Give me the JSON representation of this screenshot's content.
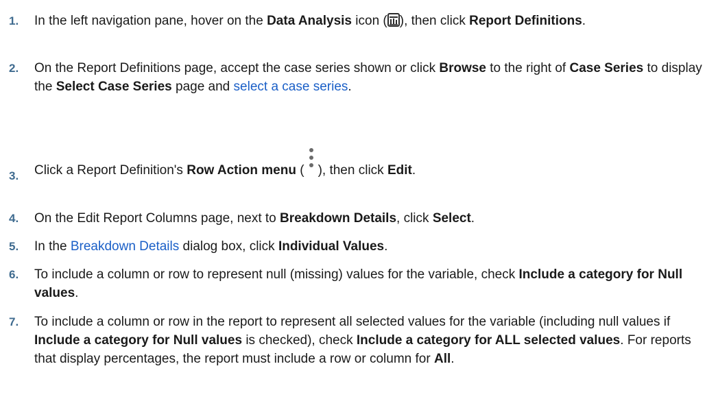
{
  "steps": [
    {
      "number": "1.",
      "parts": [
        {
          "t": "text",
          "v": "In the left navigation pane, hover on the "
        },
        {
          "t": "bold",
          "v": "Data Analysis"
        },
        {
          "t": "text",
          "v": " icon ("
        },
        {
          "t": "icon",
          "v": "data-analysis-icon"
        },
        {
          "t": "text",
          "v": "), then click "
        },
        {
          "t": "bold",
          "v": "Report Definitions"
        },
        {
          "t": "text",
          "v": "."
        }
      ]
    },
    {
      "number": "2.",
      "parts": [
        {
          "t": "text",
          "v": "On the Report Definitions page, accept the case series shown or click "
        },
        {
          "t": "bold",
          "v": "Browse"
        },
        {
          "t": "text",
          "v": " to the right of "
        },
        {
          "t": "bold",
          "v": "Case Series"
        },
        {
          "t": "text",
          "v": " to display the "
        },
        {
          "t": "bold",
          "v": "Select Case Series"
        },
        {
          "t": "text",
          "v": " page and "
        },
        {
          "t": "link",
          "v": "select a case series"
        },
        {
          "t": "text",
          "v": "."
        }
      ]
    },
    {
      "number": "3.",
      "parts": [
        {
          "t": "text",
          "v": "Click a Report Definition's "
        },
        {
          "t": "bold",
          "v": "Row Action menu"
        },
        {
          "t": "text",
          "v": " ("
        },
        {
          "t": "icon",
          "v": "row-action-menu-icon"
        },
        {
          "t": "text",
          "v": "), then click "
        },
        {
          "t": "bold",
          "v": "Edit"
        },
        {
          "t": "text",
          "v": "."
        }
      ]
    },
    {
      "number": "4.",
      "parts": [
        {
          "t": "text",
          "v": "On the Edit Report Columns page, next to "
        },
        {
          "t": "bold",
          "v": "Breakdown Details"
        },
        {
          "t": "text",
          "v": ", click "
        },
        {
          "t": "bold",
          "v": "Select"
        },
        {
          "t": "text",
          "v": "."
        }
      ]
    },
    {
      "number": "5.",
      "parts": [
        {
          "t": "text",
          "v": "In the "
        },
        {
          "t": "link",
          "v": "Breakdown Details"
        },
        {
          "t": "text",
          "v": " dialog box, click "
        },
        {
          "t": "bold",
          "v": "Individual Values"
        },
        {
          "t": "text",
          "v": "."
        }
      ]
    },
    {
      "number": "6.",
      "parts": [
        {
          "t": "text",
          "v": "To include a column or row to represent null (missing) values for the variable, check "
        },
        {
          "t": "bold",
          "v": "Include a category for Null values"
        },
        {
          "t": "text",
          "v": "."
        }
      ]
    },
    {
      "number": "7.",
      "parts": [
        {
          "t": "text",
          "v": "To include a column or row in the report to represent all selected values for the variable (including null values if "
        },
        {
          "t": "bold",
          "v": "Include a category for Null values"
        },
        {
          "t": "text",
          "v": " is checked), check "
        },
        {
          "t": "bold",
          "v": "Include a category for ALL selected values"
        },
        {
          "t": "text",
          "v": ". For reports that display percentages, the report must include a row or column for "
        },
        {
          "t": "bold",
          "v": "All"
        },
        {
          "t": "text",
          "v": "."
        }
      ]
    }
  ]
}
